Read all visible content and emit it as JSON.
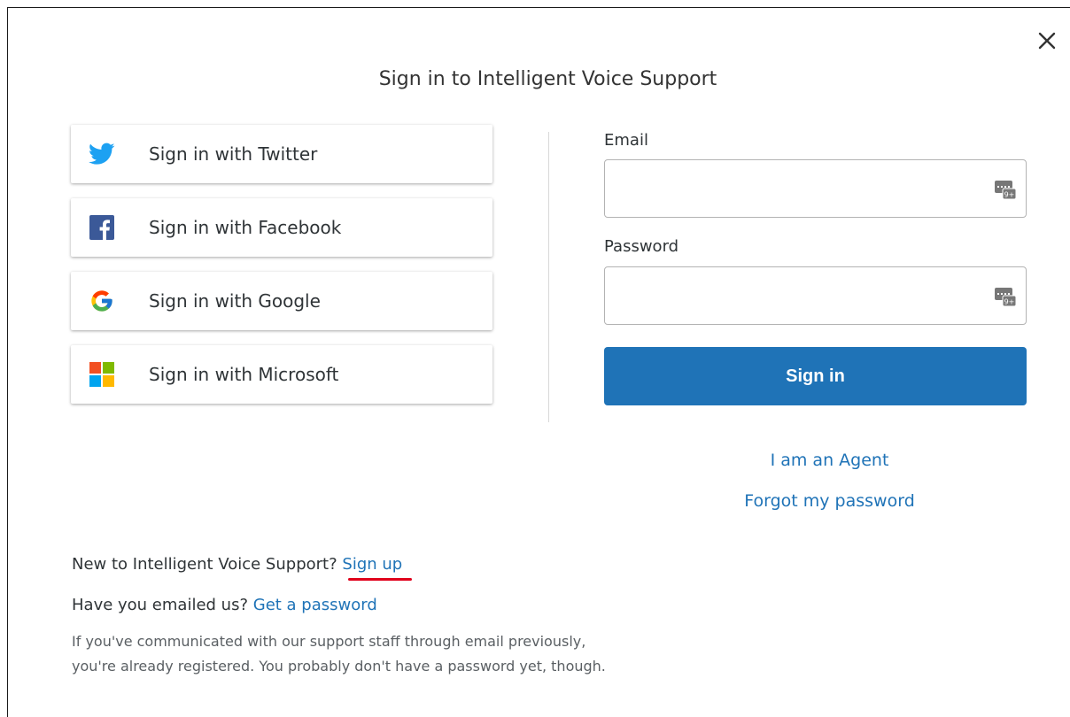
{
  "dialog": {
    "title": "Sign in to Intelligent Voice Support",
    "close_icon": "close-icon"
  },
  "social": [
    {
      "label": "Sign in with Twitter",
      "icon": "twitter-icon"
    },
    {
      "label": "Sign in with Facebook",
      "icon": "facebook-icon"
    },
    {
      "label": "Sign in with Google",
      "icon": "google-icon"
    },
    {
      "label": "Sign in with Microsoft",
      "icon": "microsoft-icon"
    }
  ],
  "form": {
    "email_label": "Email",
    "email_value": "",
    "password_label": "Password",
    "password_value": "",
    "submit_label": "Sign in",
    "field_icon": "password-manager-icon"
  },
  "links": {
    "agent": "I am an Agent",
    "forgot": "Forgot my password"
  },
  "footer": {
    "new_text": "New to Intelligent Voice Support?",
    "signup_link": "Sign up",
    "emailed_text": "Have you emailed us?",
    "get_password_link": "Get a password",
    "note_line1": "If you've communicated with our support staff through email previously,",
    "note_line2": "you're already registered. You probably don't have a password yet, though."
  },
  "colors": {
    "accent": "#1f73b7",
    "twitter": "#1da1f2",
    "facebook": "#3b5998",
    "annotation": "#e0001b"
  }
}
